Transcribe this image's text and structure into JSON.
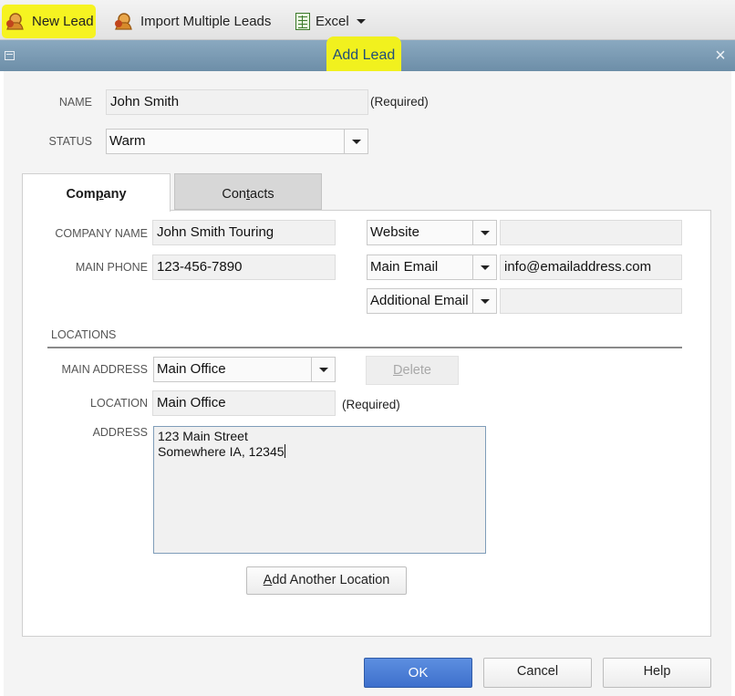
{
  "toolbar": {
    "new_lead": "New Lead",
    "import_leads": "Import Multiple Leads",
    "excel": "Excel"
  },
  "dialog": {
    "title": "Add Lead",
    "close": "×"
  },
  "lead": {
    "name_label": "NAME",
    "name_value": "John Smith",
    "name_required": "(Required)",
    "status_label": "STATUS",
    "status_value": "Warm"
  },
  "tabs": {
    "company": {
      "pre": "Com",
      "key": "p",
      "post": "any"
    },
    "contacts": {
      "pre": "Con",
      "key": "t",
      "post": "acts"
    }
  },
  "company": {
    "company_name_label": "COMPANY NAME",
    "company_name_value": "John Smith Touring",
    "main_phone_label": "MAIN PHONE",
    "main_phone_value": "123-456-7890",
    "contact_fields": [
      {
        "type": "Website",
        "value": ""
      },
      {
        "type": "Main Email",
        "value": "info@emailaddress.com"
      },
      {
        "type": "Additional Email",
        "value": ""
      }
    ]
  },
  "locations": {
    "section_label": "LOCATIONS",
    "main_address_label": "MAIN ADDRESS",
    "main_address_value": "Main Office",
    "delete": {
      "key": "D",
      "post": "elete"
    },
    "location_label": "LOCATION",
    "location_value": "Main Office",
    "location_required": "(Required)",
    "address_label": "ADDRESS",
    "address_line1": "123 Main Street",
    "address_line2": "Somewhere IA, 12345",
    "add_another": {
      "key": "A",
      "post": "dd Another Location"
    }
  },
  "footer": {
    "ok": "OK",
    "cancel": "Cancel",
    "help": "Help"
  },
  "colors": {
    "highlight": "#f6f321",
    "titlebar": "#7b9bb4",
    "ok_button": "#4a7ed8"
  },
  "icons": [
    "lead-icon",
    "import-leads-icon",
    "excel-icon",
    "chevron-down-icon",
    "close-icon",
    "system-menu-icon"
  ]
}
